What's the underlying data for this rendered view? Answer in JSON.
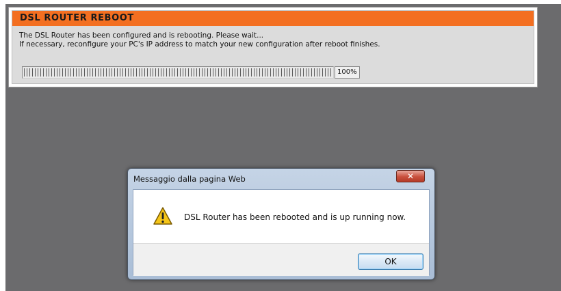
{
  "router_page": {
    "header": "DSL ROUTER REBOOT",
    "line1": "The DSL Router has been configured and is rebooting. Please wait...",
    "line2": "If necessary, reconfigure your PC's IP address to match your new configuration after reboot finishes.",
    "progress": {
      "fraction": 1.0,
      "label": "100%"
    },
    "accent_color": "#f36f21"
  },
  "dialog": {
    "title": "Messaggio dalla pagina Web",
    "close_glyph": "✕",
    "message": "DSL Router has been rebooted and is up running now.",
    "icon": "warning-icon",
    "ok_label": "OK"
  }
}
